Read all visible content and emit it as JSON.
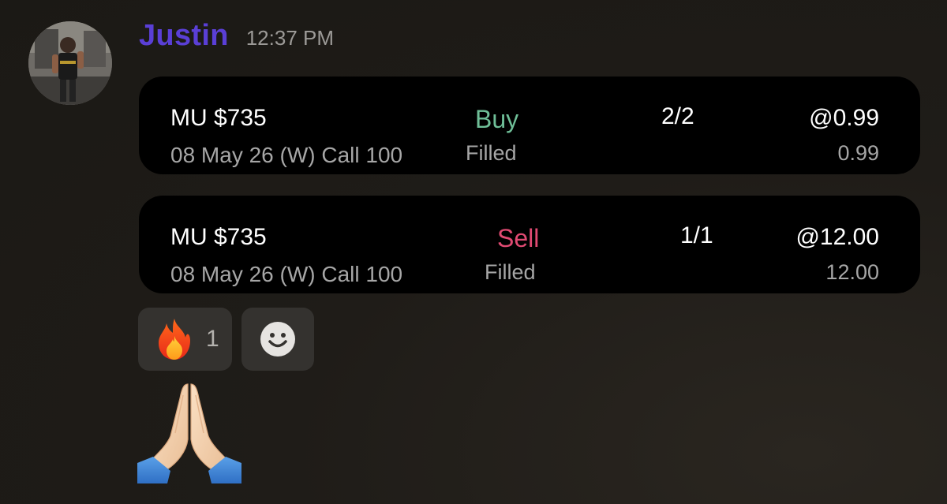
{
  "message": {
    "username": "Justin",
    "timestamp": "12:37 PM",
    "avatar": "user-avatar-photo"
  },
  "orders": [
    {
      "symbol": "MU $735",
      "contract": "08 May 26 (W) Call 100",
      "side": "Buy",
      "status": "Filled",
      "quantity": "2/2",
      "limit_price": "@0.99",
      "fill_price": "0.99",
      "side_color": "#6fbf98"
    },
    {
      "symbol": "MU $735",
      "contract": "08 May 26 (W) Call 100",
      "side": "Sell",
      "status": "Filled",
      "quantity": "1/1",
      "limit_price": "@12.00",
      "fill_price": "12.00",
      "side_color": "#e04a72"
    }
  ],
  "reactions": [
    {
      "emoji": "fire-emoji",
      "count": "1"
    }
  ],
  "add_reaction_icon": "smiley-face-icon",
  "followup_emoji": "folded-hands-emoji",
  "colors": {
    "username": "#5a3fd6",
    "card_background": "#000000",
    "page_background": "#1f1c18"
  }
}
